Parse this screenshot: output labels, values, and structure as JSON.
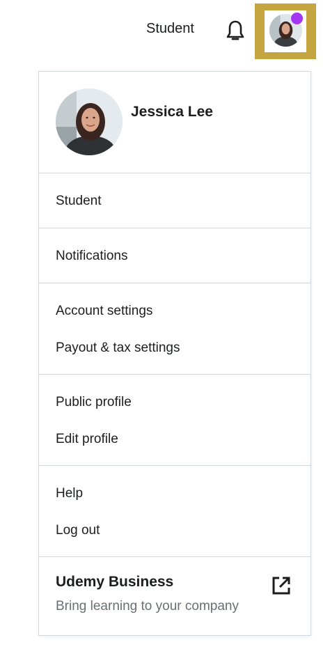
{
  "header": {
    "nav_label": "Student",
    "notification_icon": "bell-icon",
    "avatar_status_color": "#a435f0",
    "avatar_highlight_color": "#c4a53f"
  },
  "profile": {
    "name": "Jessica Lee"
  },
  "menu": {
    "student": "Student",
    "notifications": "Notifications",
    "account_settings": "Account settings",
    "payout_tax": "Payout & tax settings",
    "public_profile": "Public profile",
    "edit_profile": "Edit profile",
    "help": "Help",
    "log_out": "Log out"
  },
  "business": {
    "title": "Udemy Business",
    "subtitle": "Bring learning to your company",
    "icon": "external-link-icon"
  }
}
